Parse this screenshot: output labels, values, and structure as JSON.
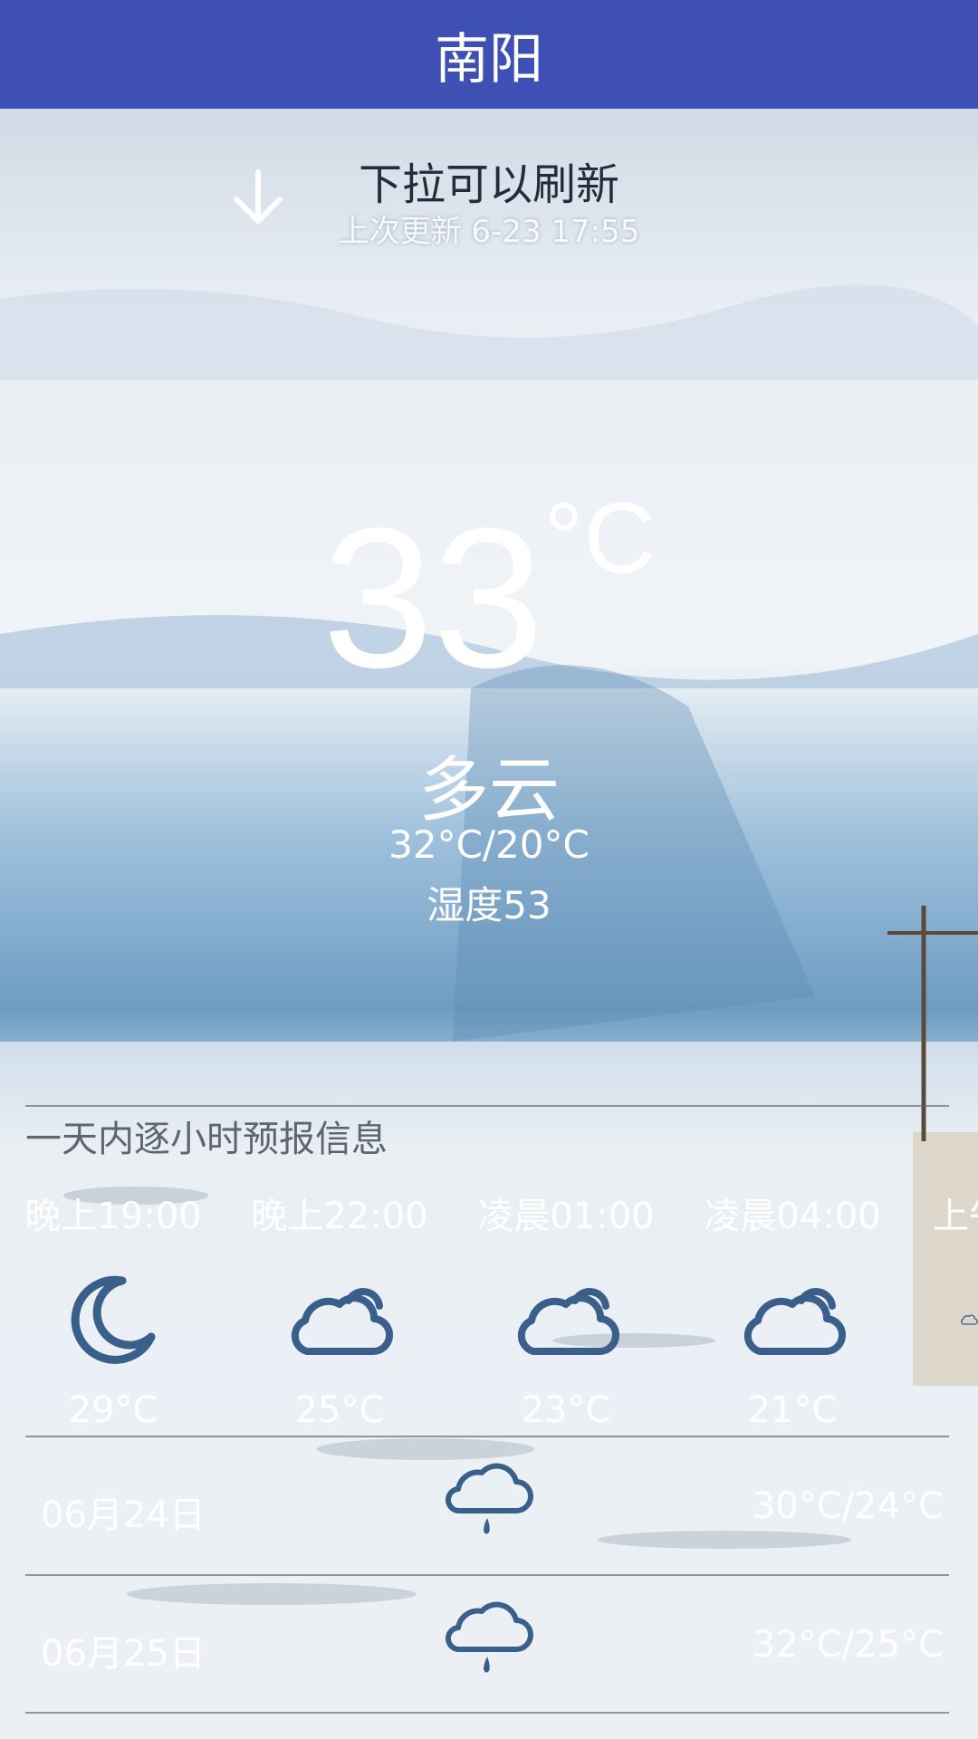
{
  "header": {
    "city": "南阳"
  },
  "refresh": {
    "hint": "下拉可以刷新",
    "last_update": "上次更新 6-23 17:55"
  },
  "current": {
    "temperature": "33",
    "unit": "°C",
    "condition": "多云",
    "range": "32°C/20°C",
    "humidity": "湿度53"
  },
  "hourly": {
    "title": "一天内逐小时预报信息",
    "items": [
      {
        "time": "晚上19:00",
        "icon": "moon-icon",
        "temp": "29°C"
      },
      {
        "time": "晚上22:00",
        "icon": "cloud-icon",
        "temp": "25°C"
      },
      {
        "time": "凌晨01:00",
        "icon": "cloud-icon",
        "temp": "23°C"
      },
      {
        "time": "凌晨04:00",
        "icon": "cloud-icon",
        "temp": "21°C"
      },
      {
        "time": "上午",
        "icon": "cloud-icon",
        "temp": ""
      }
    ]
  },
  "daily": [
    {
      "date": "06月24日",
      "icon": "rain-cloud-icon",
      "range": "30°C/24°C"
    },
    {
      "date": "06月25日",
      "icon": "rain-cloud-icon",
      "range": "32°C/25°C"
    }
  ],
  "colors": {
    "header": "#3e50b4",
    "icon": "#3a5f8a"
  }
}
